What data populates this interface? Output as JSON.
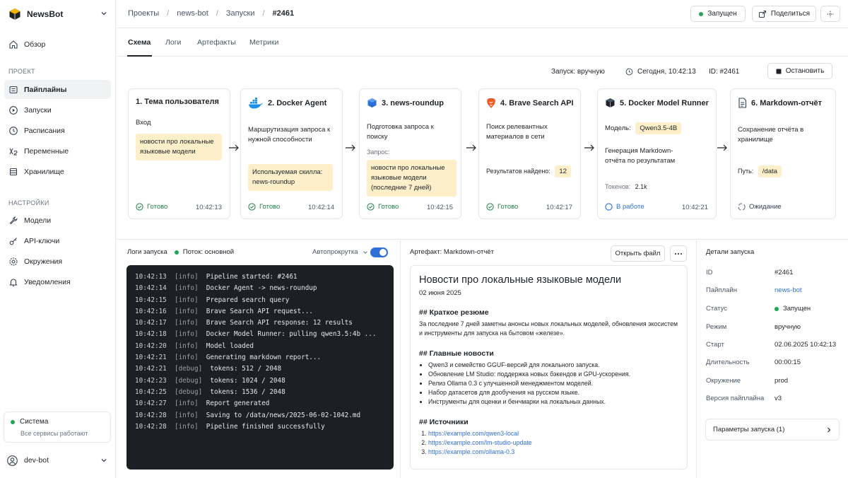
{
  "app": {
    "name": "NewsBot"
  },
  "sidebar": {
    "overview": "Обзор",
    "section_project": "ПРОЕКТ",
    "project_items": [
      "Пайплайны",
      "Запуски",
      "Расписания",
      "Переменные",
      "Хранилище"
    ],
    "section_settings": "НАСТРОЙКИ",
    "settings_items": [
      "Модели",
      "API-ключи",
      "Окружения",
      "Уведомления"
    ],
    "system": {
      "title": "Система",
      "subtitle": "Все сервисы работают"
    },
    "user": "dev-bot"
  },
  "breadcrumbs": [
    "Проекты",
    "news-bot",
    "Запуски",
    "#2461"
  ],
  "header": {
    "status_label": "Запущен",
    "share_label": "Поделиться"
  },
  "tabs": [
    "Схема",
    "Логи",
    "Артефакты",
    "Метрики"
  ],
  "run_meta": {
    "trigger": "Запуск: вручную",
    "time": "Сегодня, 10:42:13",
    "id": "ID: #2461",
    "stop_label": "Остановить"
  },
  "steps": [
    {
      "title": "1. Тема пользователя",
      "label": "Вход",
      "highlight": "новости про локальные языковые модели",
      "status": "Готово",
      "time": "10:42:13"
    },
    {
      "title": "2. Docker Agent",
      "text": "Маршрутизация запроса к нужной способности",
      "highlight": "Используемая скилла: news-roundup",
      "status": "Готово",
      "time": "10:42:14"
    },
    {
      "title": "3. news-roundup",
      "text": "Подготовка запроса к поиску",
      "label": "Запрос:",
      "highlight": "новости про локальные языковые модели (последние 7 дней)",
      "status": "Готово",
      "time": "10:42:15"
    },
    {
      "title": "4. Brave Search API",
      "text": "Поиск релевантных материалов в сети",
      "label": "Результатов найдено:",
      "highlight": "12",
      "status": "Готово",
      "time": "10:42:17"
    },
    {
      "title": "5. Docker Model Runner",
      "label": "Модель:",
      "highlight": "Qwen3.5-4B",
      "text": "Генерация Markdown-отчёта по результатам",
      "extra_label": "Токенов:",
      "extra_value": "2.1k",
      "status": "В работе",
      "time": "10:42:21"
    },
    {
      "title": "6. Markdown-отчёт",
      "text": "Сохранение отчёта в хранилище",
      "label": "Путь:",
      "highlight": "/data",
      "status": "Ожидание",
      "time": ""
    }
  ],
  "logs": {
    "title": "Логи запуска",
    "stream": "Поток: основной",
    "autoscroll": "Автопрокрутка",
    "autoscroll_on": true,
    "lines": [
      {
        "t": "10:42:13",
        "lvl": "[info]",
        "msg": "Pipeline started: #2461"
      },
      {
        "t": "10:42:14",
        "lvl": "[info]",
        "msg": "Docker Agent -> news-roundup"
      },
      {
        "t": "10:42:15",
        "lvl": "[info]",
        "msg": "Prepared search query"
      },
      {
        "t": "10:42:16",
        "lvl": "[info]",
        "msg": "Brave Search API request..."
      },
      {
        "t": "10:42:17",
        "lvl": "[info]",
        "msg": "Brave Search API response: 12 results"
      },
      {
        "t": "10:42:18",
        "lvl": "[info]",
        "msg": "Docker Model Runner: pulling qwen3.5:4b ..."
      },
      {
        "t": "10:42:20",
        "lvl": "[info]",
        "msg": "Model loaded"
      },
      {
        "t": "10:42:21",
        "lvl": "[info]",
        "msg": "Generating markdown report..."
      },
      {
        "t": "10:42:21",
        "lvl": "[debug]",
        "msg": "tokens: 512 / 2048"
      },
      {
        "t": "10:42:23",
        "lvl": "[debug]",
        "msg": "tokens: 1024 / 2048"
      },
      {
        "t": "10:42:25",
        "lvl": "[debug]",
        "msg": "tokens: 1536 / 2048"
      },
      {
        "t": "10:42:27",
        "lvl": "[info]",
        "msg": "Report generated"
      },
      {
        "t": "10:42:28",
        "lvl": "[info]",
        "msg": "Saving to /data/news/2025-06-02-1042.md"
      },
      {
        "t": "10:42:28",
        "lvl": "[info]",
        "msg": "Pipeline finished successfully"
      }
    ]
  },
  "artifact": {
    "label": "Артефакт: Markdown-отчёт",
    "open_label": "Открыть файл",
    "title": "Новости про локальные языковые модели",
    "date": "02 июня 2025",
    "summary_heading": "## Краткое резюме",
    "summary": "За последние 7 дней заметны анонсы новых локальных моделей, обновления экосистем и инструменты для запуска на бытовом «железе».",
    "news_heading": "## Главные новости",
    "news": [
      "Qwen3 и семейство GGUF-версий для локального запуска.",
      "Обновление LM Studio: поддержка новых бэкендов и GPU-ускорения.",
      "Релиз Ollama 0.3 с улучшенной менеджментом моделей.",
      "Набор датасетов для дообучения на русском языке.",
      "Инструменты для оценки и бенчмарки на локальных данных."
    ],
    "sources_heading": "## Источники",
    "sources": [
      "https://example.com/qwen3-local",
      "https://example.com/lm-studio-update",
      "https://example.com/ollama-0.3"
    ]
  },
  "details": {
    "title": "Детали запуска",
    "rows": [
      {
        "label": "ID",
        "value": "#2461"
      },
      {
        "label": "Пайплайн",
        "value": "news-bot"
      },
      {
        "label": "Статус",
        "value": "Запущен"
      },
      {
        "label": "Режим",
        "value": "вручную"
      },
      {
        "label": "Старт",
        "value": "02.06.2025 10:42:13"
      },
      {
        "label": "Длительность",
        "value": "00:00:15"
      },
      {
        "label": "Окружение",
        "value": "prod"
      },
      {
        "label": "Версия пайплайна",
        "value": "v3"
      }
    ],
    "params": "Параметры запуска (1)"
  },
  "colors": {
    "success": "#22a559",
    "link": "#2f6fd8",
    "highlight": "#fcefc9",
    "terminal_bg": "#1c1f23"
  }
}
